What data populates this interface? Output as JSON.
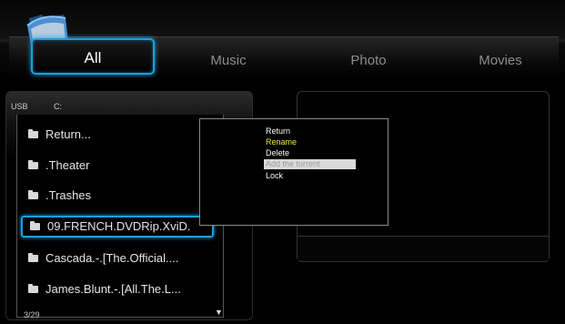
{
  "tabs": [
    {
      "label": "All",
      "active": true
    },
    {
      "label": "Music",
      "active": false
    },
    {
      "label": "Photo",
      "active": false
    },
    {
      "label": "Movies",
      "active": false
    }
  ],
  "location": {
    "device": "USB",
    "drive": "C:"
  },
  "file_list": [
    {
      "label": "Return...",
      "selected": false
    },
    {
      "label": ".Theater",
      "selected": false
    },
    {
      "label": ".Trashes",
      "selected": false
    },
    {
      "label": "09.FRENCH.DVDRip.XviD.",
      "selected": true
    },
    {
      "label": "Cascada.-.[The.Official....",
      "selected": false
    },
    {
      "label": "James.Blunt.-.[All.The.L...",
      "selected": false
    }
  ],
  "page_indicator": "3/29",
  "scroll_indicator": "▼",
  "context_menu": [
    {
      "label": "Return",
      "state": "normal"
    },
    {
      "label": "Rename",
      "state": "highlighted"
    },
    {
      "label": "Delete",
      "state": "normal"
    },
    {
      "label": "Add the torrent",
      "state": "disabled"
    },
    {
      "label": "Lock",
      "state": "normal"
    }
  ],
  "colors": {
    "accent": "#1b9fe0",
    "highlight_text": "#f2e63a",
    "background": "#000000"
  },
  "icons": {
    "logo": "folder-icon",
    "list_item": "folder-icon"
  }
}
